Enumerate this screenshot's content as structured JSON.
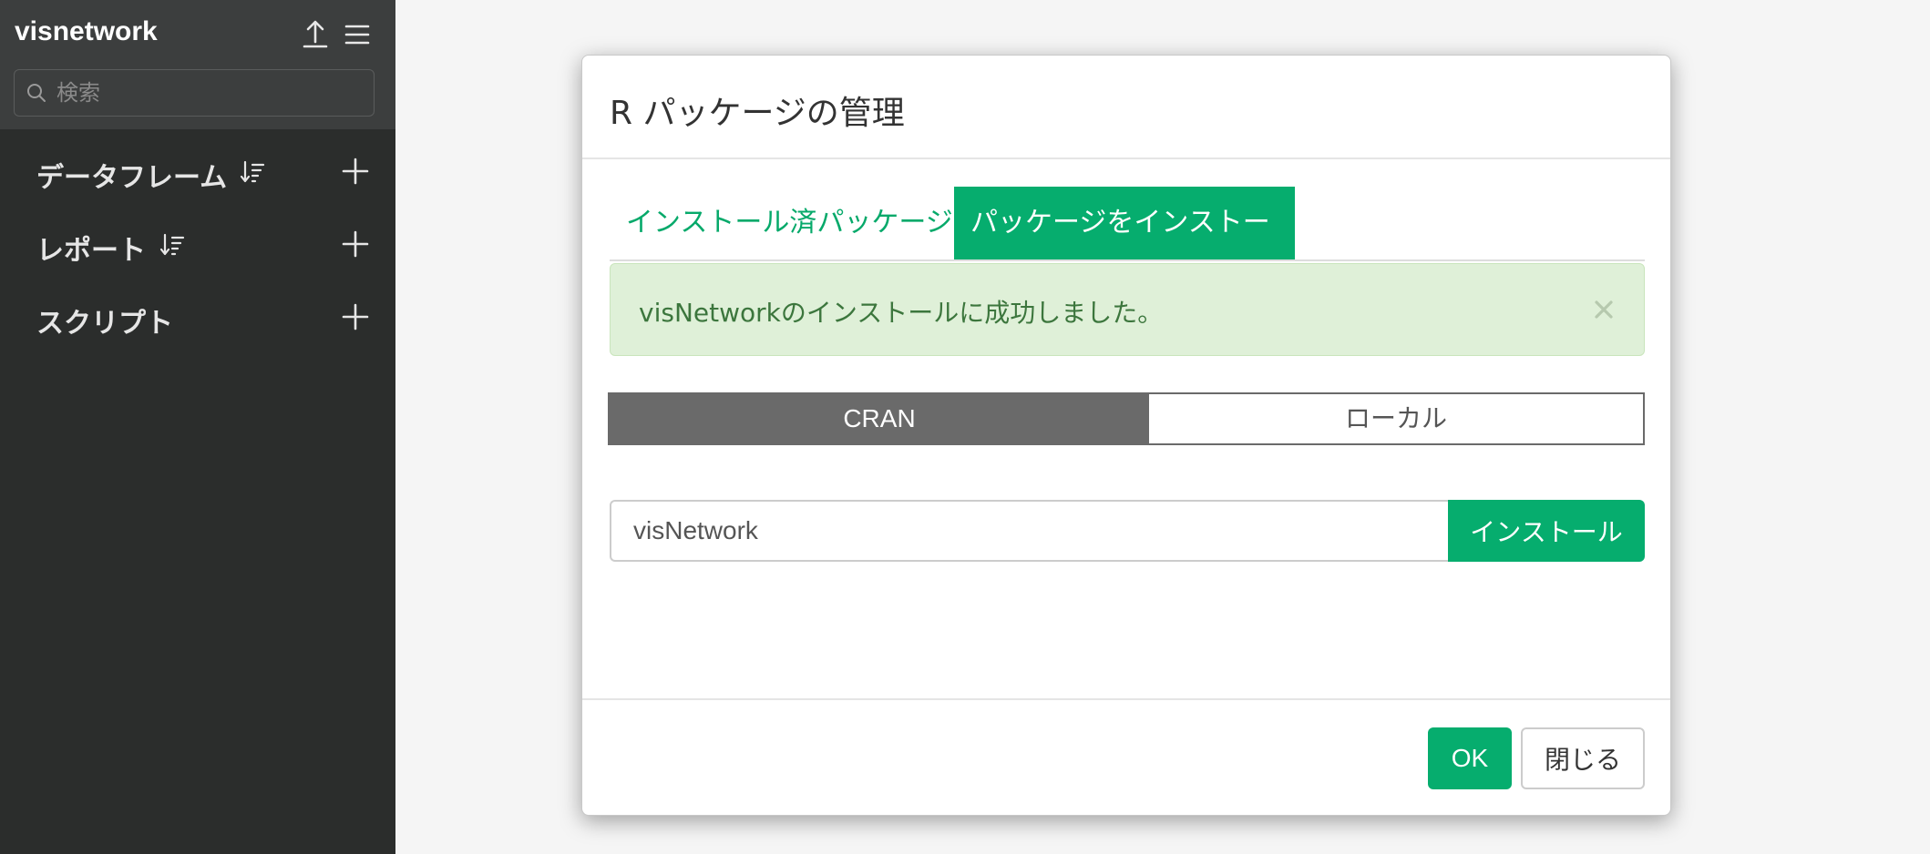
{
  "sidebar": {
    "project_name": "visnetwork",
    "search_placeholder": "検索",
    "sections": [
      {
        "label": "データフレーム",
        "sortable": true
      },
      {
        "label": "レポート",
        "sortable": true
      },
      {
        "label": "スクリプト",
        "sortable": false
      }
    ]
  },
  "icons": {
    "upload": "upload-icon",
    "menu": "hamburger-menu-icon",
    "search": "search-icon",
    "sort": "sort-icon",
    "add": "plus-icon",
    "close": "close-icon"
  },
  "dialog": {
    "title": "R パッケージの管理",
    "tabs": [
      {
        "label": "インストール済パッケージ",
        "active": false
      },
      {
        "label": "パッケージをインストール",
        "active": true
      }
    ],
    "alert": {
      "message": "visNetworkのインストールに成功しました。",
      "close_glyph": "×"
    },
    "source_options": [
      {
        "label": "CRAN",
        "selected": true
      },
      {
        "label": "ローカル",
        "selected": false
      }
    ],
    "package_input_value": "visNetwork",
    "install_label": "インストール",
    "ok_label": "OK",
    "close_label": "閉じる"
  },
  "colors": {
    "accent": "#06ad6e",
    "sidebar_bg": "#2b2d2c",
    "alert_bg": "#dff0d8",
    "alert_text": "#3c763d",
    "toggle_selected": "#6a6a6a"
  }
}
